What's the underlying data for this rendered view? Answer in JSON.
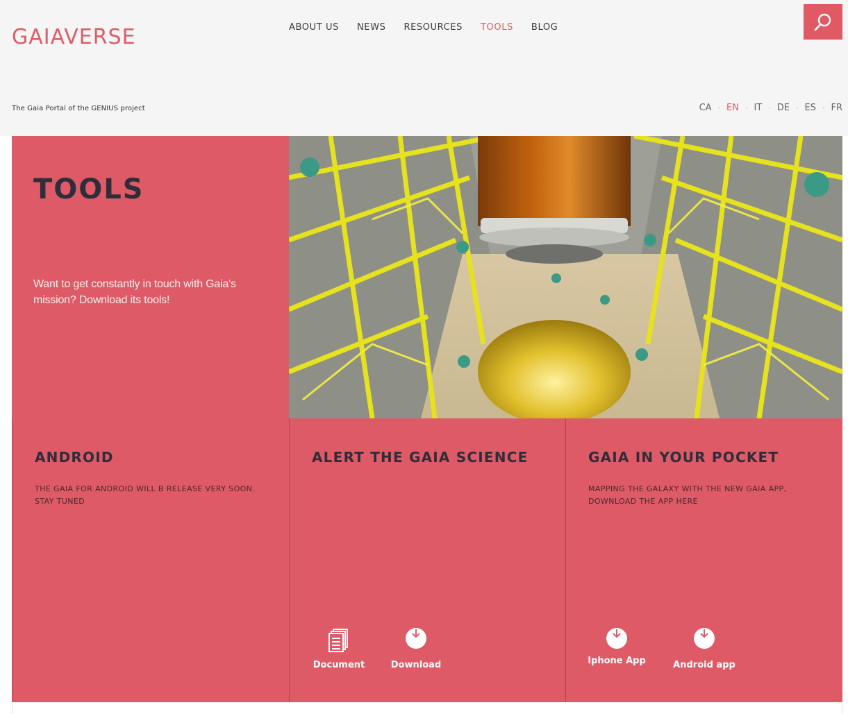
{
  "header": {
    "logo": "GAIAVERSE",
    "tagline": "The Gaia Portal of the GENIUS project",
    "nav": [
      {
        "label": "ABOUT US"
      },
      {
        "label": "NEWS"
      },
      {
        "label": "RESOURCES"
      },
      {
        "label": "TOOLS",
        "active": true
      },
      {
        "label": "BLOG"
      }
    ],
    "search_icon": "search-icon",
    "languages": [
      {
        "code": "CA"
      },
      {
        "code": "EN",
        "active": true
      },
      {
        "code": "IT"
      },
      {
        "code": "DE"
      },
      {
        "code": "ES"
      },
      {
        "code": "FR"
      }
    ]
  },
  "hero": {
    "title": "TOOLS",
    "text": "Want to get constantly in touch with Gaia's mission? Download its tools!"
  },
  "cards": [
    {
      "title": "ANDROID",
      "description": "THE GAIA FOR ANDROID WILL B RELEASE VERY SOON. STAY TUNED"
    },
    {
      "title": "ALERT THE GAIA SCIENCE",
      "description": "",
      "actions": [
        {
          "label": "Document",
          "icon": "document-icon"
        },
        {
          "label": "Download",
          "icon": "download-icon"
        }
      ]
    },
    {
      "title": "GAIA IN YOUR POCKET",
      "description": "MAPPING THE GALAXY WITH THE NEW GAIA APP, DOWNLOAD THE APP HERE",
      "actions": [
        {
          "label": "Iphone App",
          "icon": "download-icon"
        },
        {
          "label": "Android app",
          "icon": "download-icon"
        }
      ]
    }
  ],
  "colors": {
    "brand": "#dd5c66",
    "panel": "#de5a66",
    "title_dark": "#2e2e3a"
  }
}
